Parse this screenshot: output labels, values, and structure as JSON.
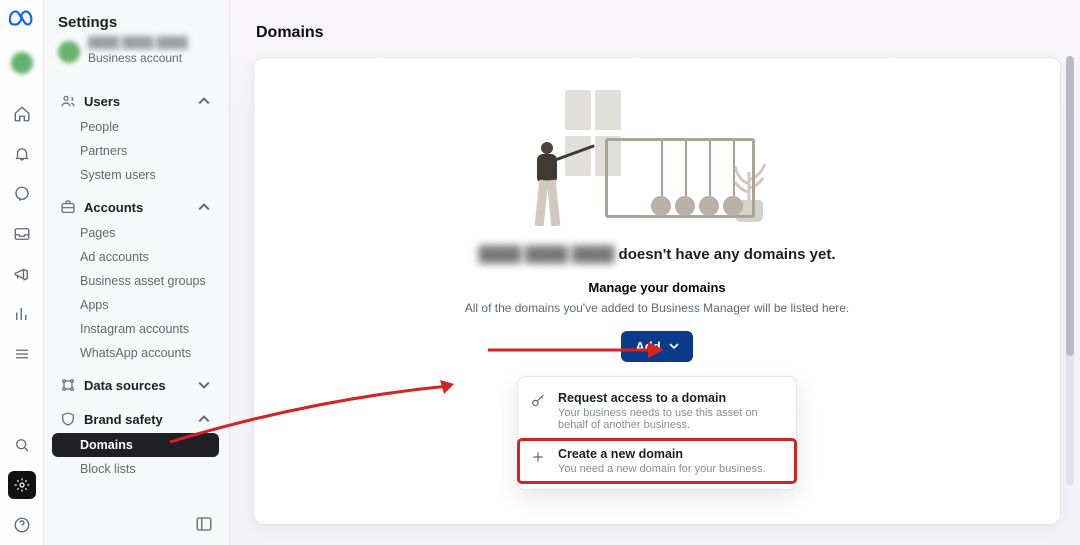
{
  "header": {
    "settings_title": "Settings",
    "account_type": "Business account"
  },
  "rail": {
    "icons": [
      "home-icon",
      "bell-icon",
      "chat-icon",
      "inbox-icon",
      "megaphone-icon",
      "bars-icon",
      "menu-icon"
    ],
    "bottom": [
      "search-icon",
      "gear-icon",
      "help-icon"
    ]
  },
  "sidebar": {
    "groups": [
      {
        "key": "users",
        "label": "Users",
        "expanded": true,
        "icon": "users-icon",
        "items": [
          {
            "key": "people",
            "label": "People"
          },
          {
            "key": "partners",
            "label": "Partners"
          },
          {
            "key": "system-users",
            "label": "System users"
          }
        ]
      },
      {
        "key": "accounts",
        "label": "Accounts",
        "expanded": true,
        "icon": "briefcase-icon",
        "items": [
          {
            "key": "pages",
            "label": "Pages"
          },
          {
            "key": "ad-accounts",
            "label": "Ad accounts"
          },
          {
            "key": "business-asset-groups",
            "label": "Business asset groups"
          },
          {
            "key": "apps",
            "label": "Apps"
          },
          {
            "key": "instagram-accounts",
            "label": "Instagram accounts"
          },
          {
            "key": "whatsapp-accounts",
            "label": "WhatsApp accounts"
          }
        ]
      },
      {
        "key": "data-sources",
        "label": "Data sources",
        "expanded": false,
        "icon": "datasource-icon",
        "items": []
      },
      {
        "key": "brand-safety",
        "label": "Brand safety",
        "expanded": true,
        "icon": "shield-icon",
        "items": [
          {
            "key": "domains",
            "label": "Domains",
            "active": true
          },
          {
            "key": "block-lists",
            "label": "Block lists"
          }
        ]
      }
    ]
  },
  "main": {
    "page_title": "Domains",
    "empty_title_suffix": " doesn't have any domains yet.",
    "manage_heading": "Manage your domains",
    "manage_desc": "All of the domains you've added to Business Manager will be listed here.",
    "add_label": "Add",
    "menu": [
      {
        "key": "request-access",
        "title": "Request access to a domain",
        "desc": "Your business needs to use this asset on behalf of another business.",
        "icon": "key-icon"
      },
      {
        "key": "create-domain",
        "title": "Create a new domain",
        "desc": "You need a new domain for your business.",
        "icon": "plus-icon",
        "highlight": true
      }
    ]
  }
}
